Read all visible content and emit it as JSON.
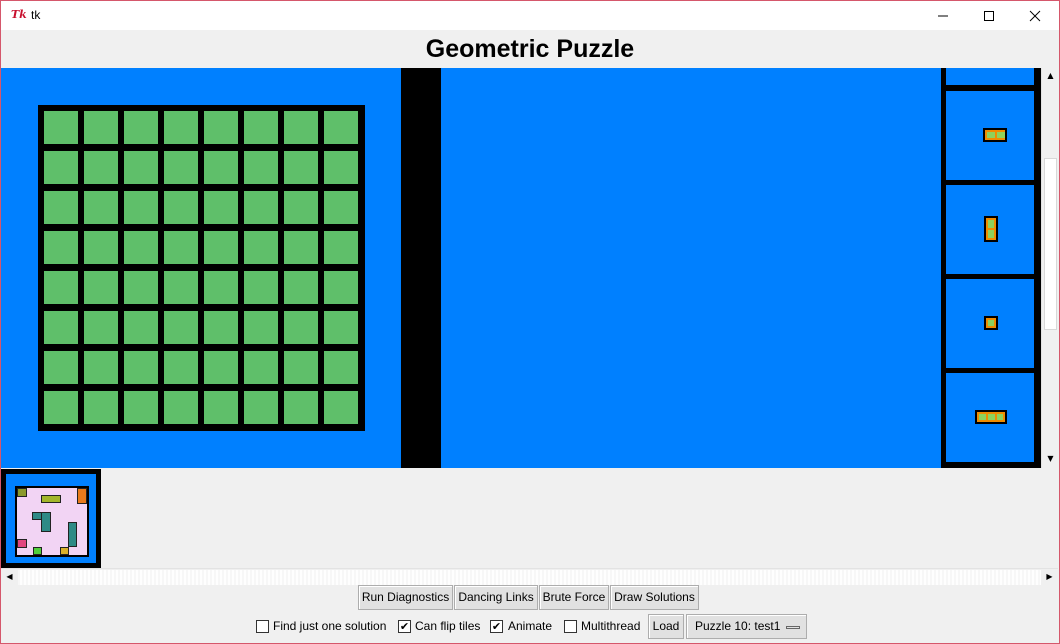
{
  "window": {
    "title": "tk",
    "icon_glyph": "Tk",
    "controls": [
      "minimize-icon",
      "maximize-icon",
      "close-icon"
    ]
  },
  "heading": "Geometric Puzzle",
  "colors": {
    "canvas_bg": "#0080ff",
    "cell_fill": "#5fbf6a",
    "grid_line": "#000000",
    "piece_outer": "#f08c00",
    "piece_inner": "#8fd15b",
    "preview_board": "#f2d4f4"
  },
  "board": {
    "rows": 8,
    "cols": 8
  },
  "tiles": [
    {
      "name": "tile-bar-2",
      "cols": 2,
      "rows": 1
    },
    {
      "name": "tile-bar-vertical-2",
      "cols": 1,
      "rows": 2
    },
    {
      "name": "tile-single",
      "cols": 1,
      "rows": 1
    },
    {
      "name": "tile-bar-3",
      "cols": 3,
      "rows": 1
    }
  ],
  "buttons": {
    "run_diagnostics": "Run Diagnostics",
    "dancing_links": "Dancing Links",
    "brute_force": "Brute Force",
    "draw_solutions": "Draw Solutions",
    "load": "Load"
  },
  "options": {
    "find_one": {
      "label": "Find just one solution",
      "checked": false
    },
    "flip": {
      "label": "Can flip tiles",
      "checked": true
    },
    "animate": {
      "label": "Animate",
      "checked": true
    },
    "multithread": {
      "label": "Multithread",
      "checked": false
    }
  },
  "puzzle_select": {
    "value": "Puzzle 10: test1"
  },
  "check_glyph": "✔"
}
